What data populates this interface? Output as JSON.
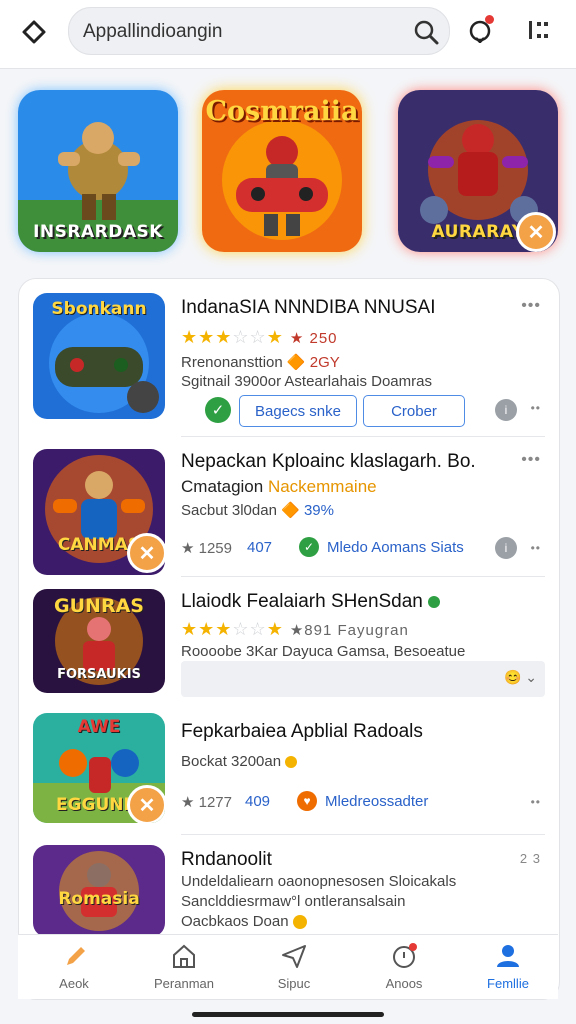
{
  "header": {
    "search_text": "Appallindioangin",
    "icons": [
      "back-icon",
      "search-icon",
      "bell-icon",
      "menu-icon"
    ]
  },
  "featured": [
    {
      "top_label": "",
      "label": "INSRARDASK"
    },
    {
      "top_label": "Cosmraiia",
      "label": ""
    },
    {
      "top_label": "",
      "label": "AURARAY"
    }
  ],
  "list": [
    {
      "thumb_label": "Sbonkann",
      "title": "IndanaSIA NNNDIBA NNUSAI",
      "stars_on": 3,
      "rating_text": "★ 250",
      "line2": "Rrenonansttion",
      "line2_badge": "🔶 2GY",
      "line3": "Sgitnail 3900or  Astearlahais  Doamras",
      "btn1": "Bagecs snke",
      "btn2": "Crober"
    },
    {
      "thumb_label": "CANMAS",
      "title": "Nepackan Kploainc klaslagarh. Bo.",
      "line2": "Cmatagion",
      "line2_highlight": "Nackemmaine",
      "line3": "Sacbut 3l0dan",
      "line3_badge": "🔶 39%",
      "meta1": "★ 1259",
      "meta2": "407",
      "meta3": "Mledo Aomans Siats"
    },
    {
      "thumb_label": "GUNRAS",
      "thumb_label2": "FORSAUKIS",
      "title": "Llaiodk Fealaiarh SHenSdan",
      "stars_on": 3,
      "rating_text": "★891  Fayugran",
      "line3": "Roooobe 3Kar  Dayuca  Gamsa, Besoeatue"
    },
    {
      "thumb_label": "AWE",
      "thumb_label2": "EGGUNIS",
      "title": "Fepkarbaiea Apblial Radoals",
      "line2": "Bockat 3200an",
      "meta1": "★ 1277",
      "meta2": "409",
      "meta3": "Mledreossadter"
    },
    {
      "thumb_label": "Romasia",
      "title": "Rndanoolit",
      "line2": "Undeldaliearn oaonopnesosen Sloicakals",
      "line3": "Sanclddiesrmaw°l  ontleransalsain",
      "line4": "Oacbkaos Doan",
      "corner": "2 3"
    }
  ],
  "tabs": [
    {
      "label": "Aeok",
      "icon": "rocket-icon"
    },
    {
      "label": "Peranman",
      "icon": "home-icon"
    },
    {
      "label": "Sipuc",
      "icon": "send-icon"
    },
    {
      "label": "Anoos",
      "icon": "notification-icon"
    },
    {
      "label": "Femllie",
      "icon": "profile-icon",
      "active": true
    }
  ],
  "colors": {
    "accent": "#1e6fe0",
    "star": "#f5b301",
    "badge": "#f3a248"
  }
}
